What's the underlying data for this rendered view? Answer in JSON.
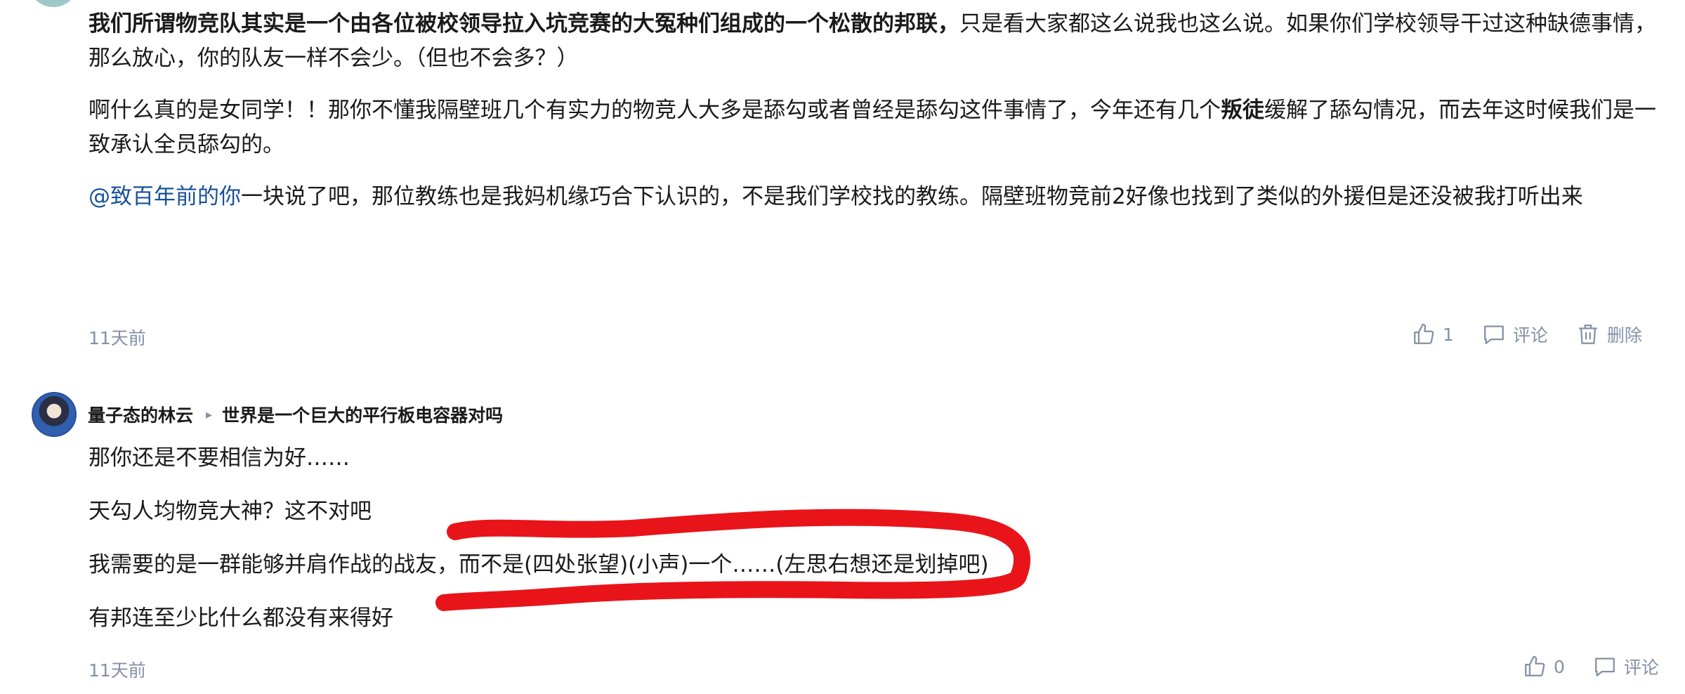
{
  "comment1": {
    "para1_bold": "我们所谓物竞队其实是一个由各位被校领导拉入坑竞赛的大冤种们组成的一个松散的邦联，",
    "para1_rest": "只是看大家都这么说我也这么说。如果你们学校领导干过这种缺德事情，那么放心，你的队友一样不会少。（但也不会多？）",
    "para2_a": "啊什么真的是女同学！！那你不懂我隔壁班几个有实力的物竞人大多是舔勾或者曾经是舔勾这件事情了，今年还有几个",
    "para2_bold": "叛徒",
    "para2_b": "缓解了舔勾情况，而去年这时候我们是一致承认全员舔勾的。",
    "para3_mention": "@致百年前的你",
    "para3_rest": "一块说了吧，那位教练也是我妈机缘巧合下认识的，不是我们学校找的教练。隔壁班物竞前2好像也找到了类似的外援但是还没被我打听出来",
    "time": "11天前",
    "like_count": "1",
    "comment_label": "评论",
    "delete_label": "删除"
  },
  "comment2": {
    "author": "量子态的林云",
    "reply_to": "世界是一个巨大的平行板电容器对吗",
    "lines": [
      "那你还是不要相信为好……",
      "天勾人均物竞大神？这不对吧",
      "我需要的是一群能够并肩作战的战友，而不是(四处张望)(小声)一个……(左思右想还是划掉吧)",
      "有邦连至少比什么都没有来得好"
    ],
    "time": "11天前",
    "like_count": "0",
    "comment_label": "评论"
  },
  "colors": {
    "scribble": "#e8141a",
    "mention": "#175199",
    "meta": "#8590a6"
  },
  "icons": [
    "thumbs-up-icon",
    "comment-icon",
    "trash-icon",
    "caret-right-icon"
  ]
}
